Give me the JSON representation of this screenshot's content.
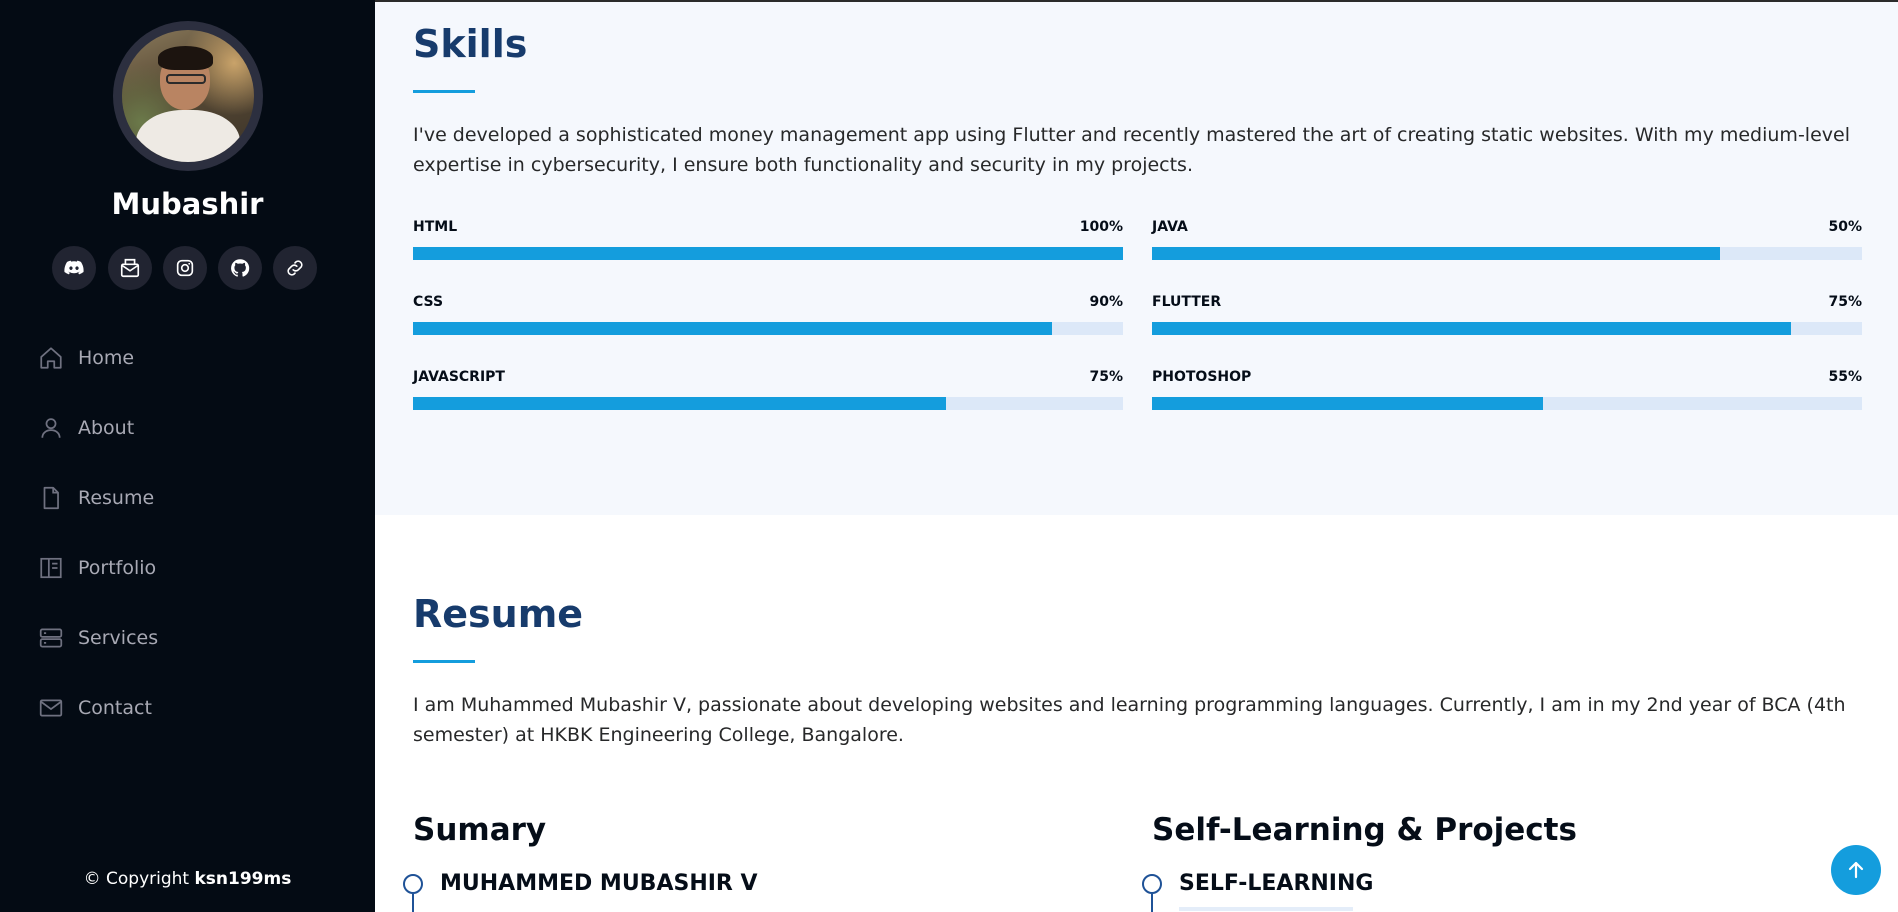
{
  "profile": {
    "name": "Mubashir"
  },
  "social_links": [
    {
      "icon": "discord-icon",
      "label": "Discord"
    },
    {
      "icon": "mail-icon",
      "label": "Email"
    },
    {
      "icon": "instagram-icon",
      "label": "Instagram"
    },
    {
      "icon": "github-icon",
      "label": "GitHub"
    },
    {
      "icon": "link-icon",
      "label": "Link"
    }
  ],
  "nav": {
    "items": [
      {
        "label": "Home",
        "icon": "house-icon"
      },
      {
        "label": "About",
        "icon": "person-icon"
      },
      {
        "label": "Resume",
        "icon": "file-icon"
      },
      {
        "label": "Portfolio",
        "icon": "book-icon"
      },
      {
        "label": "Services",
        "icon": "server-icon"
      },
      {
        "label": "Contact",
        "icon": "envelope-icon"
      }
    ]
  },
  "footer": {
    "copyright_prefix": "© Copyright ",
    "copyright_owner": "ksn199ms"
  },
  "skills": {
    "title": "Skills",
    "description": "I've developed a sophisticated money management app using Flutter and recently mastered the art of creating static websites. With my medium-level expertise in cybersecurity, I ensure both functionality and security in my projects.",
    "left": [
      {
        "name": "HTML",
        "value": "100%",
        "level": 100
      },
      {
        "name": "CSS",
        "value": "90%",
        "level": 90
      },
      {
        "name": "JAVASCRIPT",
        "value": "75%",
        "level": 75
      }
    ],
    "right": [
      {
        "name": "JAVA",
        "value": "50%",
        "level": 80
      },
      {
        "name": "FLUTTER",
        "value": "75%",
        "level": 90
      },
      {
        "name": "PHOTOSHOP",
        "value": "55%",
        "level": 55
      }
    ]
  },
  "resume": {
    "title": "Resume",
    "description": "I am Muhammed Mubashir V, passionate about developing websites and learning programming languages. Currently, I am in my 2nd year of BCA (4th semester) at HKBK Engineering College, Bangalore.",
    "summary_title": "Sumary",
    "summary_item": "MUHAMMED MUBASHIR V",
    "projects_title": "Self-Learning & Projects",
    "projects_item": "SELF-LEARNING"
  },
  "colors": {
    "accent": "#149ddd",
    "heading": "#173b6c",
    "sidebar_bg": "#040b14"
  }
}
